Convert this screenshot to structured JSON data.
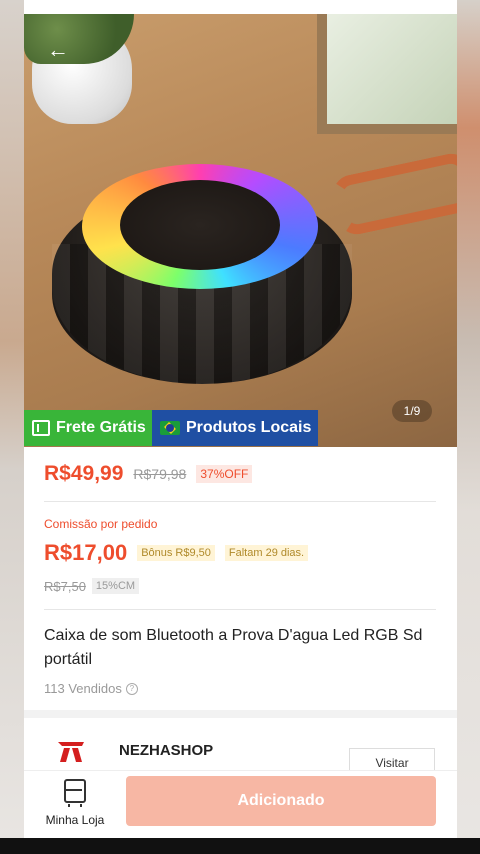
{
  "gallery": {
    "counter": "1/9"
  },
  "badges": {
    "free_shipping": "Frete Grátis",
    "local_products": "Produtos Locais"
  },
  "pricing": {
    "price": "R$49,99",
    "original_price": "R$79,98",
    "discount": "37%OFF"
  },
  "commission": {
    "label": "Comissão por pedido",
    "amount": "R$17,00",
    "bonus": "Bônus R$9,50",
    "days_left": "Faltam 29 dias.",
    "old_amount": "R$7,50",
    "rate": "15%CM"
  },
  "product": {
    "title": "Caixa de som Bluetooth a Prova D'agua Led RGB Sd portátil",
    "sold": "113 Vendidos"
  },
  "shop": {
    "name": "NEZHASHOP",
    "visit_label": "Visitar"
  },
  "bottom_nav": {
    "store_label": "Minha Loja",
    "add_label": "Adicionado"
  },
  "colors": {
    "accent": "#ee4d2d",
    "free_shipping_bg": "#39b539",
    "local_bg": "#1f4fa3",
    "add_button_bg": "#f7b7a4"
  },
  "icons": [
    "back-arrow-icon",
    "coupon-icon",
    "brazil-flag-icon",
    "info-icon",
    "shop-logo-icon",
    "store-icon"
  ]
}
